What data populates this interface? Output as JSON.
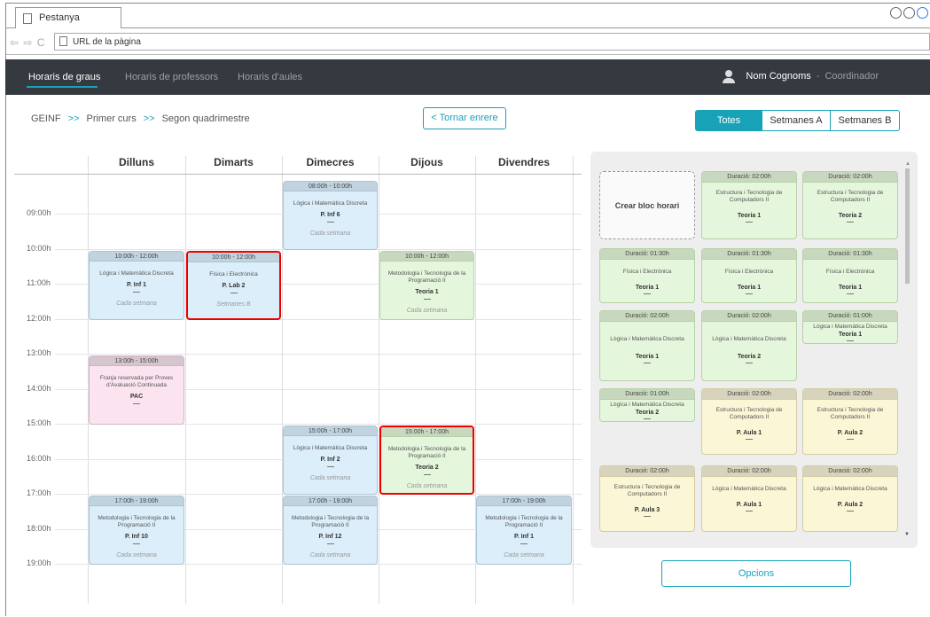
{
  "browser": {
    "tab_title": "Pestanya",
    "url_placeholder": "URL de la pàgina"
  },
  "nav": {
    "items": [
      "Horaris de graus",
      "Horaris de professors",
      "Horaris d'aules"
    ],
    "active": 0,
    "user_name": "Nom Cognoms",
    "user_separator": "-",
    "user_role": "Coordinador"
  },
  "breadcrumb": {
    "items": [
      "GEINF",
      "Primer curs",
      "Segon quadrimestre"
    ],
    "separator": ">>"
  },
  "back_button": "< Tornar enrere",
  "filter": {
    "options": [
      "Totes",
      "Setmanes A",
      "Setmanes B"
    ],
    "selected": "Totes"
  },
  "calendar": {
    "days": [
      "Dilluns",
      "Dimarts",
      "Dimecres",
      "Dijous",
      "Divendres"
    ],
    "hours": [
      "09:00h",
      "10:00h",
      "11:00h",
      "12:00h",
      "13:00h",
      "14:00h",
      "15:00h",
      "16:00h",
      "17:00h",
      "18:00h",
      "19:00h"
    ],
    "events": [
      {
        "day": 2,
        "time": "08:00h - 10:00h",
        "start": 8,
        "end": 10,
        "subject": "Lògica i Matemàtica Discreta",
        "room": "P. Inf 6",
        "week": "Cada setmana",
        "color": "blue",
        "selected": false
      },
      {
        "day": 0,
        "time": "10:00h - 12:00h",
        "start": 10,
        "end": 12,
        "subject": "Lògica i Matemàtica Discreta",
        "room": "P. Inf 1",
        "week": "Cada setmana",
        "color": "blue",
        "selected": false
      },
      {
        "day": 1,
        "time": "10:00h - 12:00h",
        "start": 10,
        "end": 12,
        "subject": "Física i Electrònica",
        "room": "P. Lab 2",
        "week": "Setmanes B",
        "color": "blue",
        "selected": true
      },
      {
        "day": 3,
        "time": "10:00h - 12:00h",
        "start": 10,
        "end": 12,
        "subject": "Metodologia i Tecnologia de la Programació II",
        "room": "Teoria 1",
        "week": "Cada setmana",
        "color": "green",
        "selected": false
      },
      {
        "day": 0,
        "time": "13:00h - 15:00h",
        "start": 13,
        "end": 15,
        "subject": "Franja reservada per Proves d'Avaluació Continuada",
        "room": "PAC",
        "week": "",
        "color": "pink",
        "selected": false
      },
      {
        "day": 2,
        "time": "15:00h - 17:00h",
        "start": 15,
        "end": 17,
        "subject": "Lògica i Matemàtica Discreta",
        "room": "P. Inf 2",
        "week": "Cada setmana",
        "color": "blue",
        "selected": false
      },
      {
        "day": 3,
        "time": "15:00h - 17:00h",
        "start": 15,
        "end": 17,
        "subject": "Metodologia i Tecnologia de la Programació II",
        "room": "Teoria 2",
        "week": "Cada setmana",
        "color": "green",
        "selected": true
      },
      {
        "day": 0,
        "time": "17:00h - 19:00h",
        "start": 17,
        "end": 19,
        "subject": "Metodologia i Tecnologia de la Programació II",
        "room": "P. Inf 10",
        "week": "Cada setmana",
        "color": "blue",
        "selected": false
      },
      {
        "day": 2,
        "time": "17:00h - 19:00h",
        "start": 17,
        "end": 19,
        "subject": "Metodologia i Tecnologia de la Programació II",
        "room": "P. Inf 12",
        "week": "Cada setmana",
        "color": "blue",
        "selected": false
      },
      {
        "day": 4,
        "time": "17:00h - 19:00h",
        "start": 17,
        "end": 19,
        "subject": "Metodologia i Tecnologia de la Programació II",
        "room": "P. Inf 1",
        "week": "Cada setmana",
        "color": "blue",
        "selected": false
      }
    ]
  },
  "blocks": {
    "create_label": "Crear bloc horari",
    "duration_prefix": "Duració:",
    "cards": [
      {
        "duration": "02:00h",
        "subject": "Estructura i Tecnologia de Computadors II",
        "room": "Teoria 1",
        "color": "green"
      },
      {
        "duration": "02:00h",
        "subject": "Estructura i Tecnologia de Computadors II",
        "room": "Teoria 2",
        "color": "green"
      },
      {
        "duration": "01:30h",
        "subject": "Física i Electrònica",
        "room": "Teoria 1",
        "color": "green"
      },
      {
        "duration": "01:30h",
        "subject": "Física i Electrònica",
        "room": "Teoria 1",
        "color": "green"
      },
      {
        "duration": "01:30h",
        "subject": "Física i Electrònica",
        "room": "Teoria 1",
        "color": "green"
      },
      {
        "duration": "02:00h",
        "subject": "Lògica i Matemàtica Discreta",
        "room": "Teoria 1",
        "color": "green"
      },
      {
        "duration": "02:00h",
        "subject": "Lògica i Matemàtica Discreta",
        "room": "Teoria 2",
        "color": "green"
      },
      {
        "duration": "01:00h",
        "subject": "Lògica i Matemàtica Discreta",
        "room": "Teoria 1",
        "color": "green"
      },
      {
        "duration": "01:00h",
        "subject": "Lògica i Matemàtica Discreta",
        "room": "Teoria 2",
        "color": "green"
      },
      {
        "duration": "02:00h",
        "subject": "Estructura i Tecnologia de Computadors II",
        "room": "P. Aula 1",
        "color": "yellow"
      },
      {
        "duration": "02:00h",
        "subject": "Estructura i Tecnologia de Computadors II",
        "room": "P. Aula 2",
        "color": "yellow"
      },
      {
        "duration": "02:00h",
        "subject": "Estructura i Tecnologia de Computadors II",
        "room": "P. Aula 3",
        "color": "yellow"
      },
      {
        "duration": "02:00h",
        "subject": "Lògica i Matemàtica Discreta",
        "room": "P. Aula 1",
        "color": "yellow"
      },
      {
        "duration": "02:00h",
        "subject": "Lògica i Matemàtica Discreta",
        "room": "P. Aula 2",
        "color": "yellow"
      }
    ]
  },
  "options_button": "Opcions"
}
